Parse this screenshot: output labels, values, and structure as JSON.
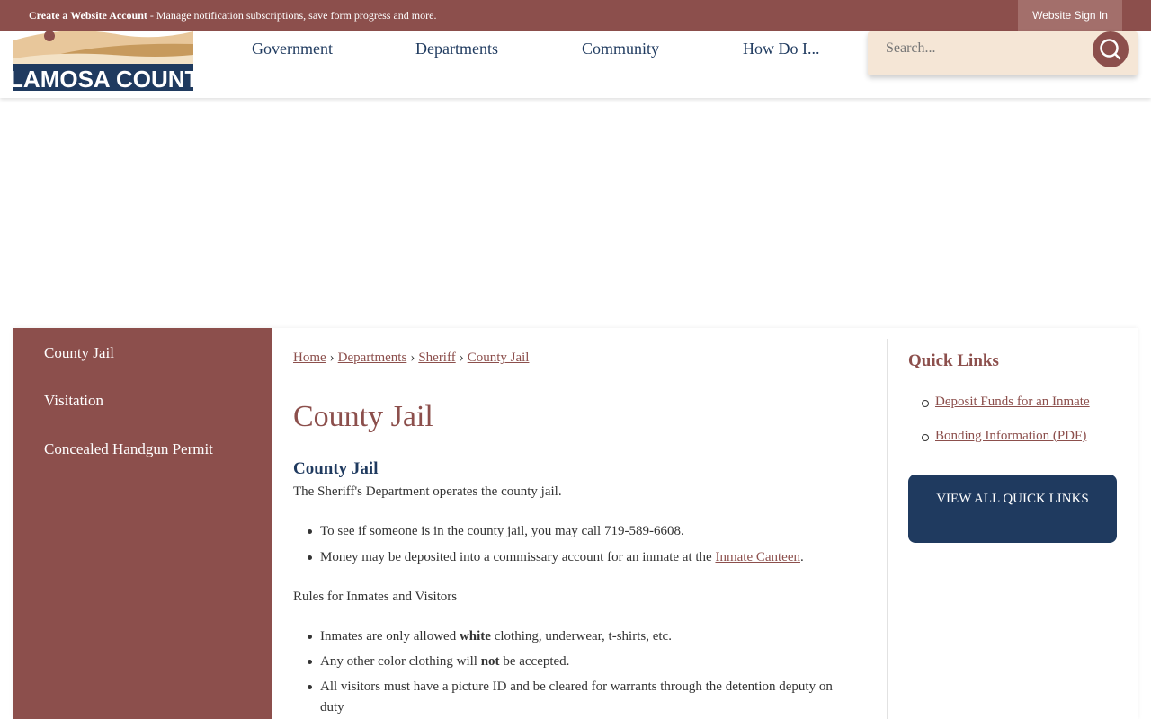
{
  "topbar": {
    "create_account": "Create a Website Account",
    "message": " - Manage notification subscriptions, save form progress and more.",
    "signin": "Website Sign In"
  },
  "header": {
    "logo_text": "ALAMOSA COUNTY",
    "nav": [
      "Government",
      "Departments",
      "Community",
      "How Do I..."
    ],
    "search_placeholder": "Search..."
  },
  "sidebar": {
    "items": [
      "County Jail",
      "Visitation",
      "Concealed Handgun Permit"
    ]
  },
  "breadcrumb": [
    "Home",
    "Departments",
    "Sheriff",
    "County Jail"
  ],
  "main": {
    "title": "County Jail",
    "subtitle": "County Jail",
    "intro": "The Sheriff's Department operates the county jail.",
    "list1": [
      "To see if someone is in the county jail, you may call 719-589-6608.",
      "Money may be deposited into a commissary account for an inmate at the "
    ],
    "canteen_link": "Inmate Canteen",
    "canteen_after": ".",
    "rules_heading": "Rules for Inmates and Visitors",
    "rule1_before": "Inmates are only allowed ",
    "rule1_bold": "white",
    "rule1_after": " clothing, underwear, t-shirts, etc.",
    "rule2_before": "Any other color clothing will ",
    "rule2_bold": "not",
    "rule2_after": " be accepted.",
    "rule3": "All visitors must have a picture ID and be cleared for warrants through the detention deputy on duty"
  },
  "quick_links": {
    "title": "Quick Links",
    "items": [
      "Deposit Funds for an Inmate",
      "Bonding Information (PDF)"
    ],
    "view_all": "VIEW ALL QUICK LINKS"
  },
  "colors": {
    "brand": "#8c4f4c",
    "navy": "#1f3a5f",
    "search_bg": "#f5e6d6"
  }
}
